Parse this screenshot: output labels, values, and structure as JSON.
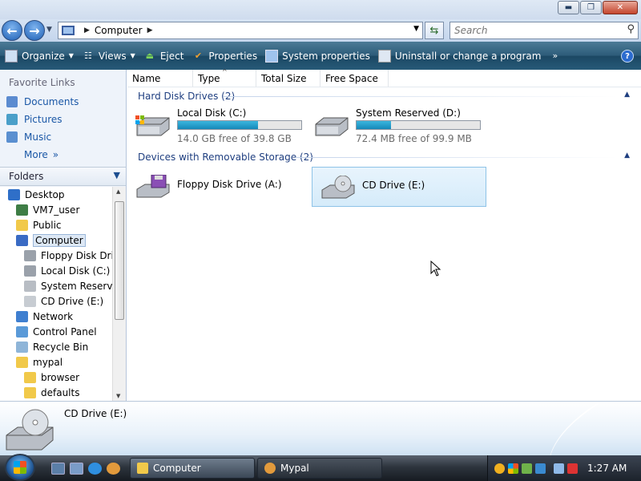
{
  "titlebar": {
    "buttons": {
      "minimize": "▬",
      "maximize": "❐",
      "close": "✕"
    }
  },
  "address": {
    "location": "Computer",
    "search_placeholder": "Search"
  },
  "commandbar": {
    "items": [
      {
        "label": "Organize",
        "icon": "organize-icon",
        "dropdown": true
      },
      {
        "label": "Views",
        "icon": "views-icon",
        "dropdown": true
      },
      {
        "label": "Eject",
        "icon": "eject-icon",
        "dropdown": false
      },
      {
        "label": "Properties",
        "icon": "properties-icon",
        "dropdown": false
      },
      {
        "label": "System properties",
        "icon": "system-properties-icon",
        "dropdown": false
      },
      {
        "label": "Uninstall or change a program",
        "icon": "uninstall-icon",
        "dropdown": false
      }
    ],
    "more": "»",
    "help": "?"
  },
  "sidebar": {
    "favorites_title": "Favorite Links",
    "favorites": [
      {
        "label": "Documents",
        "icon": "documents-icon",
        "color": "#5b8bd0"
      },
      {
        "label": "Pictures",
        "icon": "pictures-icon",
        "color": "#4a9fc9"
      },
      {
        "label": "Music",
        "icon": "music-icon",
        "color": "#5a8fd0"
      }
    ],
    "more_label": "More",
    "more_arrow": "»",
    "folders_title": "Folders",
    "tree": [
      {
        "label": "Desktop",
        "icon": "desktop-icon",
        "indent": 0
      },
      {
        "label": "VM7_user",
        "icon": "user-folder-icon",
        "indent": 1
      },
      {
        "label": "Public",
        "icon": "folder-icon",
        "indent": 1
      },
      {
        "label": "Computer",
        "icon": "computer-icon",
        "indent": 1,
        "selected": true
      },
      {
        "label": "Floppy Disk Drive",
        "icon": "floppy-drive-icon",
        "indent": 2
      },
      {
        "label": "Local Disk (C:)",
        "icon": "local-disk-icon",
        "indent": 2
      },
      {
        "label": "System Reserved",
        "icon": "hard-drive-icon",
        "indent": 2
      },
      {
        "label": "CD Drive (E:)",
        "icon": "cd-drive-icon",
        "indent": 2
      },
      {
        "label": "Network",
        "icon": "network-icon",
        "indent": 1
      },
      {
        "label": "Control Panel",
        "icon": "control-panel-icon",
        "indent": 1
      },
      {
        "label": "Recycle Bin",
        "icon": "recycle-bin-icon",
        "indent": 1
      },
      {
        "label": "mypal",
        "icon": "folder-icon",
        "indent": 1
      },
      {
        "label": "browser",
        "icon": "folder-icon",
        "indent": 2
      },
      {
        "label": "defaults",
        "icon": "folder-icon",
        "indent": 2
      }
    ]
  },
  "columns": [
    "Name",
    "Type",
    "Total Size",
    "Free Space"
  ],
  "groups": {
    "hard_disks": {
      "title": "Hard Disk Drives (2)",
      "drives": [
        {
          "name": "Local Disk (C:)",
          "free_text": "14.0 GB free of 39.8 GB",
          "used_fraction": 0.65
        },
        {
          "name": "System Reserved (D:)",
          "free_text": "72.4 MB free of 99.9 MB",
          "used_fraction": 0.28
        }
      ]
    },
    "removable": {
      "title": "Devices with Removable Storage (2)",
      "drives": [
        {
          "name": "Floppy Disk Drive (A:)"
        },
        {
          "name": "CD Drive (E:)",
          "selected": true
        }
      ]
    }
  },
  "details": {
    "name": "CD Drive (E:)"
  },
  "taskbar": {
    "tasks": [
      {
        "label": "Computer",
        "icon": "folder-icon",
        "active": true
      },
      {
        "label": "Mypal",
        "icon": "mypal-icon",
        "active": false
      }
    ],
    "clock": "1:27 AM"
  }
}
